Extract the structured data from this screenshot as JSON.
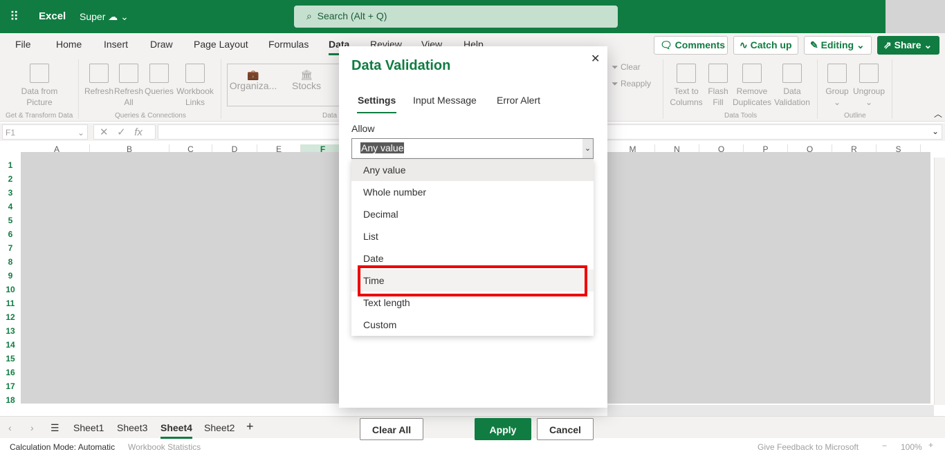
{
  "titlebar": {
    "app": "Excel",
    "doc": "Super",
    "search_placeholder": "Search (Alt + Q)"
  },
  "menu_tabs": [
    "File",
    "Home",
    "Insert",
    "Draw",
    "Page Layout",
    "Formulas",
    "Data",
    "Review",
    "View",
    "Help"
  ],
  "active_tab": "Data",
  "top_buttons": {
    "comments": "Comments",
    "catchup": "Catch up",
    "editing": "Editing",
    "share": "Share"
  },
  "ribbon": {
    "items": [
      {
        "label": "Data from Picture"
      },
      {
        "label": "Refresh"
      },
      {
        "label": "Refresh All"
      },
      {
        "label": "Queries"
      },
      {
        "label": "Workbook Links"
      },
      {
        "label": "Organiza..."
      },
      {
        "label": "Stocks"
      },
      {
        "label": "Clear"
      },
      {
        "label": "Reapply"
      },
      {
        "label": "Text to Columns"
      },
      {
        "label": "Flash Fill"
      },
      {
        "label": "Remove Duplicates"
      },
      {
        "label": "Data Validation"
      },
      {
        "label": "Group"
      },
      {
        "label": "Ungroup"
      }
    ],
    "groups": [
      "Get & Transform Data",
      "Queries & Connections",
      "Data",
      "Data Tools",
      "Outline"
    ]
  },
  "formula_bar": {
    "name_box": "F1",
    "fx": "fx"
  },
  "columns_left": [
    "A",
    "B",
    "C",
    "D",
    "E",
    "F"
  ],
  "columns_right": [
    "M",
    "N",
    "O",
    "P",
    "Q",
    "R",
    "S"
  ],
  "rows": [
    "1",
    "2",
    "3",
    "4",
    "5",
    "6",
    "7",
    "8",
    "9",
    "10",
    "11",
    "12",
    "13",
    "14",
    "15",
    "16",
    "17",
    "18"
  ],
  "sheets": [
    "Sheet1",
    "Sheet3",
    "Sheet4",
    "Sheet2"
  ],
  "active_sheet": "Sheet4",
  "status": {
    "calc": "Calculation Mode: Automatic",
    "stats": "Workbook Statistics",
    "feedback": "Give Feedback to Microsoft",
    "zoom": "100%"
  },
  "dialog": {
    "title": "Data Validation",
    "tabs": [
      "Settings",
      "Input Message",
      "Error Alert"
    ],
    "active_tab": "Settings",
    "allow_label": "Allow",
    "allow_value": "Any value",
    "options": [
      "Any value",
      "Whole number",
      "Decimal",
      "List",
      "Date",
      "Time",
      "Text length",
      "Custom"
    ],
    "highlighted_option": "Time",
    "buttons": {
      "clear": "Clear All",
      "apply": "Apply",
      "cancel": "Cancel"
    }
  },
  "colors": {
    "accent": "#107c41",
    "highlight_box": "#ee0000"
  }
}
